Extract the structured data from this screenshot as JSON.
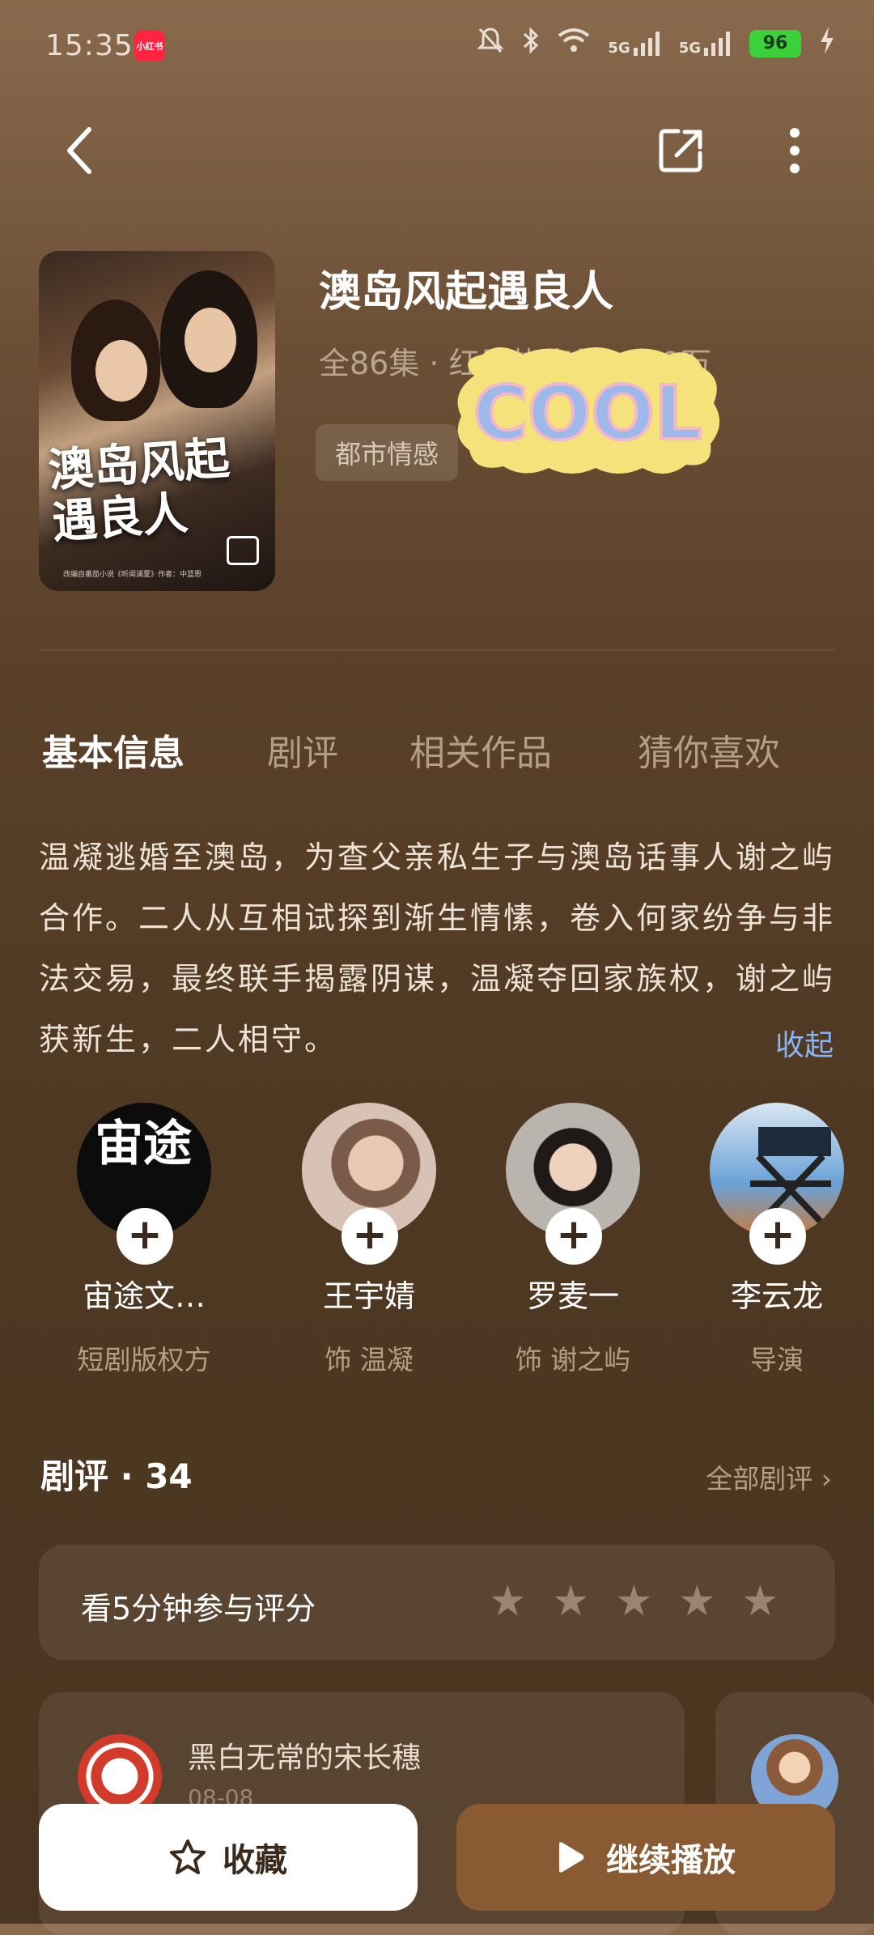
{
  "status_bar": {
    "time": "15:35",
    "app_badge": "小红书",
    "signal1": "5G",
    "signal2": "5G",
    "battery": "96"
  },
  "drama": {
    "title": "澳岛风起遇良人",
    "subtitle": "全86集 · 红果热度值1639万",
    "genre": "都市情感",
    "poster_title": "澳岛风起遇良人",
    "poster_credit": "改编自番茄小说《听闻澜夏》作者：中蓝恩",
    "sticker_text": "COOL"
  },
  "tabs": [
    "基本信息",
    "剧评",
    "相关作品",
    "猜你喜欢"
  ],
  "synopsis": "温凝逃婚至澳岛，为查父亲私生子与澳岛话事人谢之屿合作。二人从互相试探到渐生情愫，卷入何家纷争与非法交易，最终联手揭露阴谋，温凝夺回家族权，谢之屿获新生，二人相守。",
  "collapse_label": "收起",
  "cast": [
    {
      "name": "宙途文…",
      "role": "短剧版权方",
      "avatar_text": "宙途"
    },
    {
      "name": "王宇婧",
      "role": "饰 温凝"
    },
    {
      "name": "罗麦一",
      "role": "饰 谢之屿"
    },
    {
      "name": "李云龙",
      "role": "导演"
    }
  ],
  "reviews": {
    "header": "剧评 · 34",
    "all_label": "全部剧评",
    "rate_prompt": "看5分钟参与评分",
    "items": [
      {
        "user": "黑白无常的宋长穗",
        "date": "08-08"
      }
    ]
  },
  "bottom": {
    "favorite_label": "收藏",
    "play_label": "继续播放"
  },
  "colors": {
    "accent": "#8a5a32",
    "link": "#8ab4f8",
    "battery": "#3ad13a"
  }
}
